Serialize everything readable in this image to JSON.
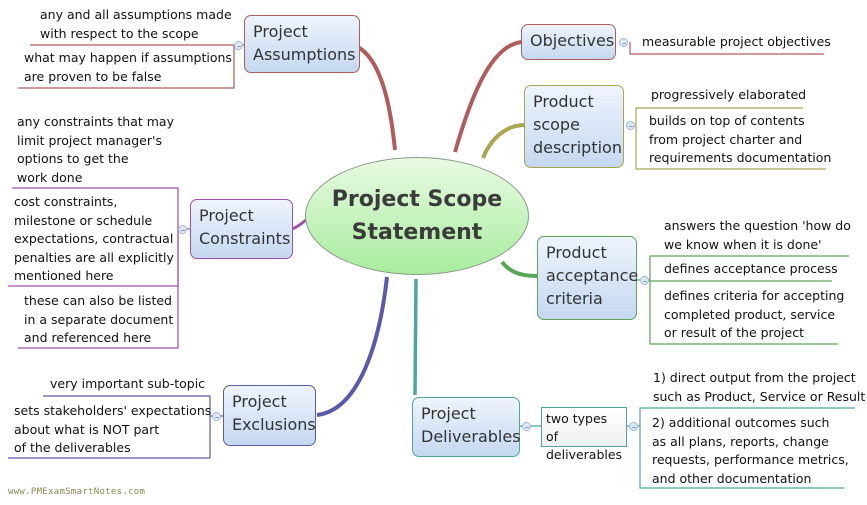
{
  "central": {
    "title": "Project Scope\nStatement"
  },
  "colors": {
    "assumptions": "#b05c5c",
    "objectives": "#b05c5c",
    "product_scope": "#a8a64e",
    "acceptance": "#5aa55a",
    "deliverables": "#4fa3a3",
    "exclusions": "#5a5aab",
    "constraints": "#a050a8",
    "central_fill": "#bdf2b4",
    "topic_fill": "#d6e4f6",
    "watermark": "#8a8a50"
  },
  "branches": {
    "assumptions": {
      "label": "Project\nAssumptions",
      "notes": [
        "any and all assumptions made\nwith respect to the scope",
        "what may happen if assumptions\nare proven to be false"
      ]
    },
    "objectives": {
      "label": "Objectives",
      "notes": [
        "measurable project objectives"
      ]
    },
    "product_scope": {
      "label": "Product\nscope\ndescription",
      "notes": [
        "progressively elaborated",
        "builds on top of contents\nfrom project charter and\nrequirements documentation"
      ]
    },
    "constraints": {
      "label": "Project\nConstraints",
      "notes": [
        "any constraints that may\nlimit project manager's\noptions to get the\nwork done",
        "cost constraints,\nmilestone or schedule\nexpectations, contractual\npenalties are all explicitly\nmentioned here",
        "these can also be listed\nin a separate document\nand referenced here"
      ]
    },
    "acceptance": {
      "label": "Product\nacceptance\ncriteria",
      "notes": [
        "answers the question 'how do\nwe know when it is done'",
        "defines acceptance process",
        "defines criteria for accepting\ncompleted product, service\nor result of the project"
      ]
    },
    "exclusions": {
      "label": "Project\nExclusions",
      "notes": [
        "very important sub-topic",
        "sets stakeholders' expectations\nabout what is NOT part\nof the deliverables"
      ]
    },
    "deliverables": {
      "label": "Project\nDeliverables",
      "subtopic": "two types of\ndeliverables",
      "notes": [
        "1) direct output from the project\nsuch as Product, Service or Result",
        "2) additional outcomes such\nas all plans, reports, change\nrequests, performance metrics,\nand other documentation"
      ]
    }
  },
  "watermark": "www.PMExamSmartNotes.com"
}
